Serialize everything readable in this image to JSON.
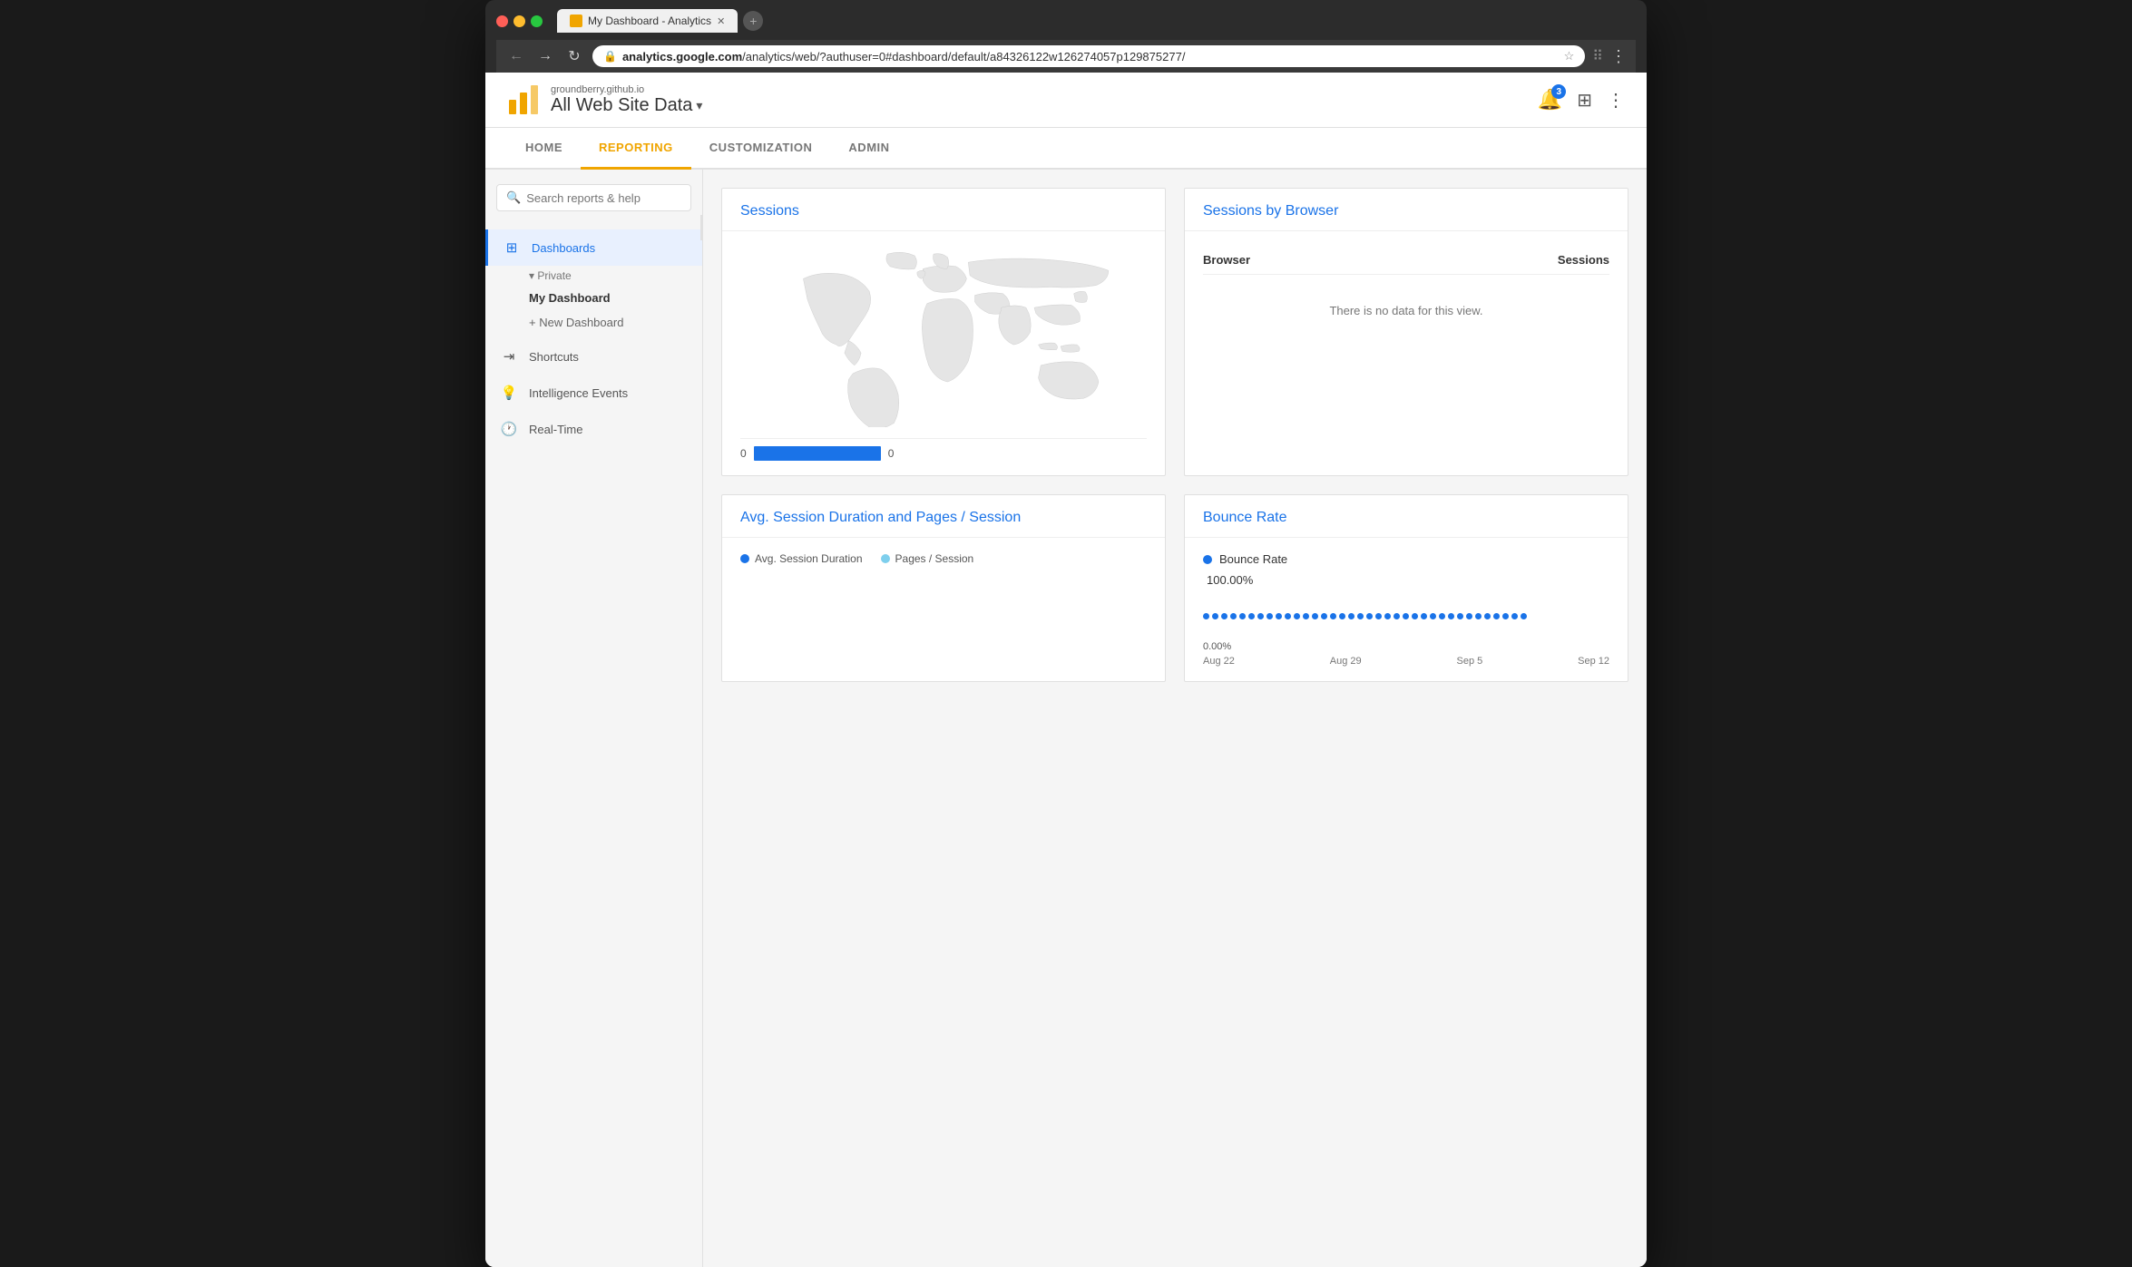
{
  "browser": {
    "tab_title": "My Dashboard - Analytics",
    "url_full": "https://analytics.google.com/analytics/web/?authuser=0#dashboard/default/a84326122w126274057p129875277/",
    "url_domain": "analytics.google.com",
    "url_path": "/analytics/web/?authuser=0#dashboard/default/a84326122w126274057p129875277/",
    "new_tab_label": "+"
  },
  "header": {
    "domain": "groundberry.github.io",
    "title": "All Web Site Data",
    "notification_count": "3"
  },
  "nav": {
    "items": [
      {
        "id": "home",
        "label": "HOME",
        "active": false
      },
      {
        "id": "reporting",
        "label": "REPORTING",
        "active": true
      },
      {
        "id": "customization",
        "label": "CUSTOMIZATION",
        "active": false
      },
      {
        "id": "admin",
        "label": "ADMIN",
        "active": false
      }
    ]
  },
  "sidebar": {
    "search_placeholder": "Search reports & help",
    "dashboards_label": "Dashboards",
    "private_label": "▾ Private",
    "my_dashboard_label": "My Dashboard",
    "new_dashboard_label": "+ New Dashboard",
    "shortcuts_label": "Shortcuts",
    "intelligence_label": "Intelligence Events",
    "realtime_label": "Real-Time"
  },
  "widgets": {
    "sessions": {
      "title": "Sessions",
      "bar_left_value": "0",
      "bar_right_value": "0"
    },
    "sessions_by_browser": {
      "title": "Sessions by Browser",
      "col_browser": "Browser",
      "col_sessions": "Sessions",
      "no_data_msg": "There is no data for this view."
    },
    "bounce_rate": {
      "title": "Bounce Rate",
      "legend_label": "Bounce Rate",
      "percent_top": "100.00%",
      "percent_bottom": "0.00%",
      "dates": [
        "Aug 22",
        "Aug 29",
        "Sep 5",
        "Sep 12"
      ]
    },
    "avg_session": {
      "title": "Avg. Session Duration and Pages / Session",
      "legend_avg": "Avg. Session Duration",
      "legend_pages": "Pages / Session"
    }
  }
}
